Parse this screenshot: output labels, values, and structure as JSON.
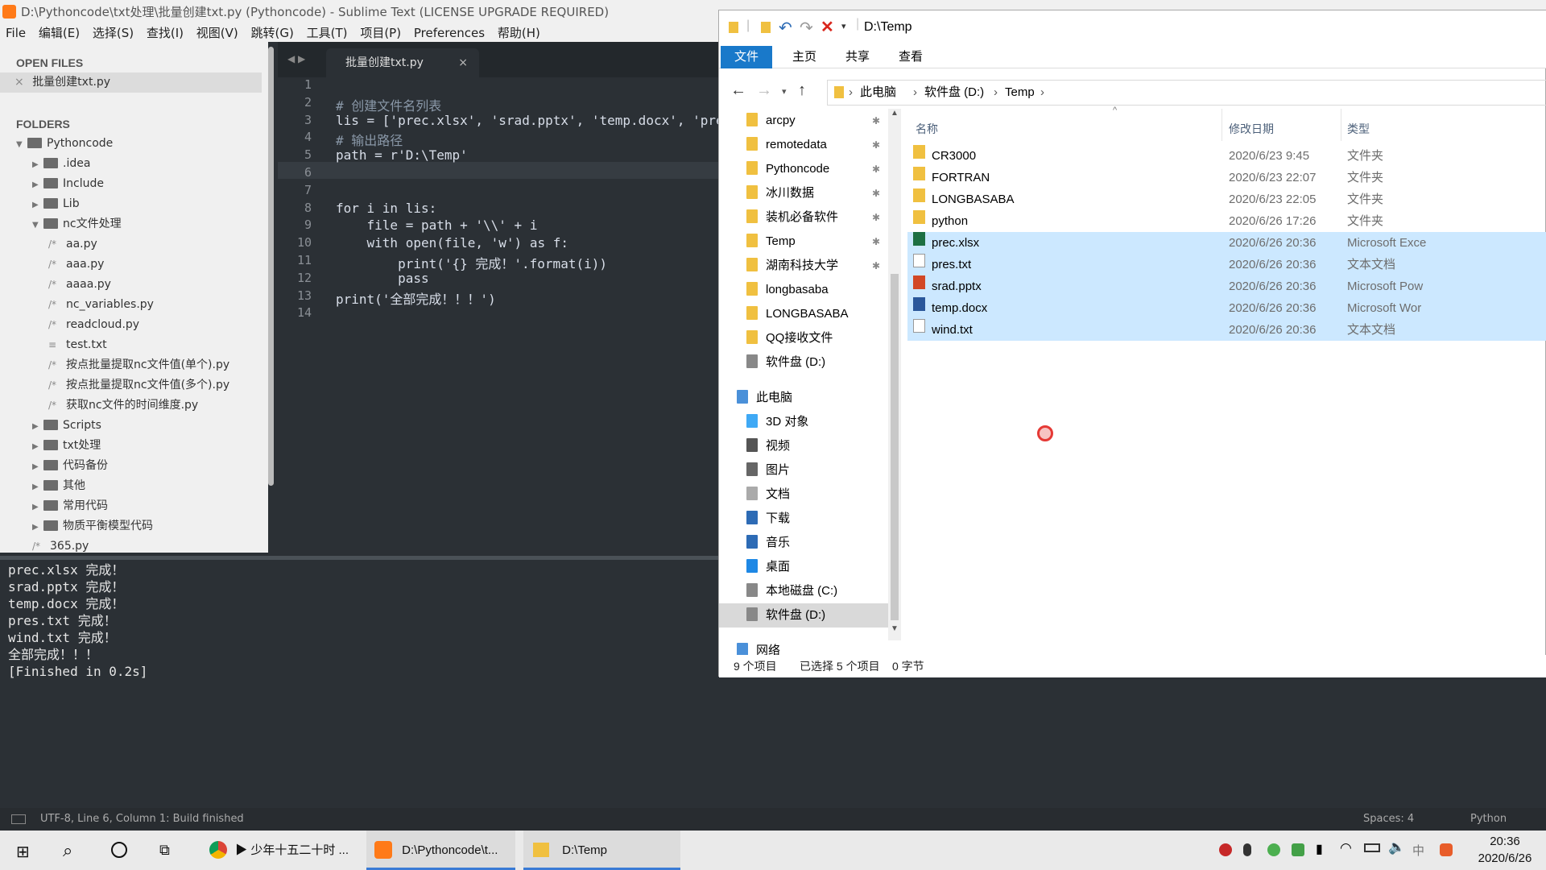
{
  "sublime": {
    "title": "D:\\Pythoncode\\txt处理\\批量创建txt.py (Pythoncode) - Sublime Text (LICENSE UPGRADE REQUIRED)",
    "menu": [
      "File",
      "编辑(E)",
      "选择(S)",
      "查找(I)",
      "视图(V)",
      "跳转(G)",
      "工具(T)",
      "项目(P)",
      "Preferences",
      "帮助(H)"
    ],
    "sidebar": {
      "open_files_header": "OPEN FILES",
      "open_file": "批量创建txt.py",
      "folders_header": "FOLDERS",
      "tree": [
        {
          "label": "Pythoncode",
          "kind": "folder-open",
          "indent": 0
        },
        {
          "label": ".idea",
          "kind": "folder",
          "indent": 1
        },
        {
          "label": "Include",
          "kind": "folder",
          "indent": 1
        },
        {
          "label": "Lib",
          "kind": "folder",
          "indent": 1
        },
        {
          "label": "nc文件处理",
          "kind": "folder-open",
          "indent": 1
        },
        {
          "label": "aa.py",
          "kind": "file",
          "indent": 2
        },
        {
          "label": "aaa.py",
          "kind": "file",
          "indent": 2
        },
        {
          "label": "aaaa.py",
          "kind": "file",
          "indent": 2
        },
        {
          "label": "nc_variables.py",
          "kind": "file",
          "indent": 2
        },
        {
          "label": "readcloud.py",
          "kind": "file",
          "indent": 2
        },
        {
          "label": "test.txt",
          "kind": "text",
          "indent": 2
        },
        {
          "label": "按点批量提取nc文件值(单个).py",
          "kind": "file",
          "indent": 2
        },
        {
          "label": "按点批量提取nc文件值(多个).py",
          "kind": "file",
          "indent": 2
        },
        {
          "label": "获取nc文件的时间维度.py",
          "kind": "file",
          "indent": 2
        },
        {
          "label": "Scripts",
          "kind": "folder",
          "indent": 1
        },
        {
          "label": "txt处理",
          "kind": "folder",
          "indent": 1
        },
        {
          "label": "代码备份",
          "kind": "folder",
          "indent": 1
        },
        {
          "label": "其他",
          "kind": "folder",
          "indent": 1
        },
        {
          "label": "常用代码",
          "kind": "folder",
          "indent": 1
        },
        {
          "label": "物质平衡模型代码",
          "kind": "folder",
          "indent": 1
        },
        {
          "label": "365.py",
          "kind": "file",
          "indent": 1
        }
      ]
    },
    "tab_label": "批量创建txt.py",
    "tab_close": "×",
    "line_numbers": [
      "1",
      "2",
      "3",
      "4",
      "5",
      "6",
      "7",
      "8",
      "9",
      "10",
      "11",
      "12",
      "13",
      "14"
    ],
    "code_lines": [
      "",
      "# 创建文件名列表",
      "lis = ['prec.xlsx', 'srad.pptx', 'temp.docx', 'pres",
      "# 输出路径",
      "path = r'D:\\Temp'",
      "",
      "",
      "for i in lis:",
      "    file = path + '\\\\' + i",
      "    with open(file, 'w') as f:",
      "        print('{} 完成！'.format(i))",
      "        pass",
      "print('全部完成！！！')",
      ""
    ],
    "console_lines": [
      "prec.xlsx 完成！",
      "srad.pptx 完成！",
      "temp.docx 完成！",
      "pres.txt 完成！",
      "wind.txt 完成！",
      "全部完成！！！",
      "[Finished in 0.2s]"
    ],
    "status_left": "UTF-8, Line 6, Column 1: Build finished",
    "status_spaces": "Spaces: 4",
    "status_syntax": "Python"
  },
  "explorer": {
    "title": "D:\\Temp",
    "ribbon_tabs": [
      "文件",
      "主页",
      "共享",
      "查看"
    ],
    "breadcrumb": [
      "此电脑",
      "软件盘 (D:)",
      "Temp"
    ],
    "nav_items": [
      {
        "label": "arcpy",
        "pinned": true,
        "icon": "folder"
      },
      {
        "label": "remotedata",
        "pinned": true,
        "icon": "folder"
      },
      {
        "label": "Pythoncode",
        "pinned": true,
        "icon": "folder"
      },
      {
        "label": "冰川数据",
        "pinned": true,
        "icon": "folder"
      },
      {
        "label": "装机必备软件",
        "pinned": true,
        "icon": "folder"
      },
      {
        "label": "Temp",
        "pinned": true,
        "icon": "folder"
      },
      {
        "label": "湖南科技大学",
        "pinned": true,
        "icon": "folder"
      },
      {
        "label": "longbasaba",
        "pinned": false,
        "icon": "folder"
      },
      {
        "label": "LONGBASABA",
        "pinned": false,
        "icon": "folder"
      },
      {
        "label": "QQ接收文件",
        "pinned": false,
        "icon": "folder"
      },
      {
        "label": "软件盘 (D:)",
        "pinned": false,
        "icon": "drive"
      },
      {
        "label": "此电脑",
        "pinned": false,
        "icon": "pc"
      },
      {
        "label": "3D 对象",
        "pinned": false,
        "icon": "3d"
      },
      {
        "label": "视频",
        "pinned": false,
        "icon": "video"
      },
      {
        "label": "图片",
        "pinned": false,
        "icon": "picture"
      },
      {
        "label": "文档",
        "pinned": false,
        "icon": "document"
      },
      {
        "label": "下载",
        "pinned": false,
        "icon": "download"
      },
      {
        "label": "音乐",
        "pinned": false,
        "icon": "music"
      },
      {
        "label": "桌面",
        "pinned": false,
        "icon": "desktop"
      },
      {
        "label": "本地磁盘 (C:)",
        "pinned": false,
        "icon": "drive"
      },
      {
        "label": "软件盘 (D:)",
        "pinned": false,
        "icon": "drive"
      },
      {
        "label": "网络",
        "pinned": false,
        "icon": "network"
      }
    ],
    "columns": {
      "name": "名称",
      "date": "修改日期",
      "type": "类型"
    },
    "files": [
      {
        "name": "CR3000",
        "date": "2020/6/23 9:45",
        "type": "文件夹",
        "icon": "folder",
        "selected": false
      },
      {
        "name": "FORTRAN",
        "date": "2020/6/23 22:07",
        "type": "文件夹",
        "icon": "folder",
        "selected": false
      },
      {
        "name": "LONGBASABA",
        "date": "2020/6/23 22:05",
        "type": "文件夹",
        "icon": "folder",
        "selected": false
      },
      {
        "name": "python",
        "date": "2020/6/26 17:26",
        "type": "文件夹",
        "icon": "folder",
        "selected": false
      },
      {
        "name": "prec.xlsx",
        "date": "2020/6/26 20:36",
        "type": "Microsoft Exce",
        "icon": "excel",
        "selected": true
      },
      {
        "name": "pres.txt",
        "date": "2020/6/26 20:36",
        "type": "文本文档",
        "icon": "text",
        "selected": true
      },
      {
        "name": "srad.pptx",
        "date": "2020/6/26 20:36",
        "type": "Microsoft Pow",
        "icon": "powerpoint",
        "selected": true
      },
      {
        "name": "temp.docx",
        "date": "2020/6/26 20:36",
        "type": "Microsoft Wor",
        "icon": "word",
        "selected": true
      },
      {
        "name": "wind.txt",
        "date": "2020/6/26 20:36",
        "type": "文本文档",
        "icon": "text",
        "selected": true
      }
    ],
    "status_count": "9 个项目",
    "status_selected": "已选择 5 个项目",
    "status_size": "0 字节"
  },
  "taskbar": {
    "items": [
      {
        "label": "▶ 少年十五二十时 ...",
        "icon": "chrome"
      },
      {
        "label": "D:\\Pythoncode\\t...",
        "icon": "sublime"
      },
      {
        "label": "D:\\Temp",
        "icon": "explorer"
      }
    ],
    "time": "20:36",
    "date": "2020/6/26",
    "ime": "中"
  }
}
